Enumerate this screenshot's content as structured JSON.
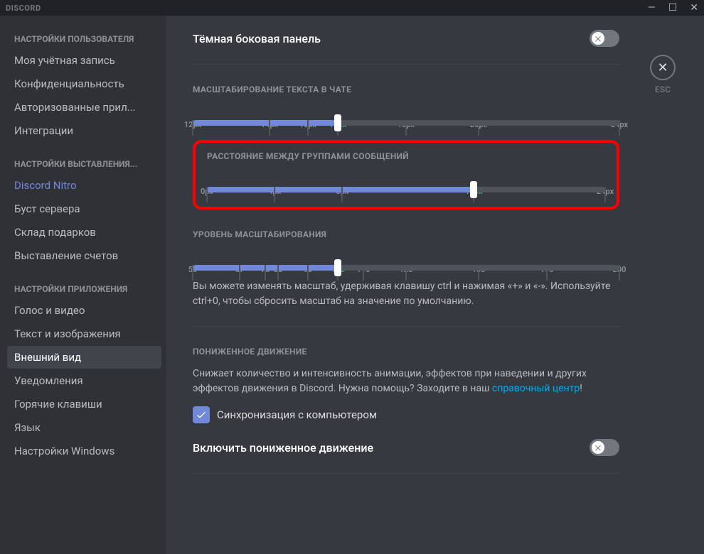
{
  "app": {
    "logo": "DISCORD",
    "esc": "ESC"
  },
  "sidebar": {
    "h1": "НАСТРОЙКИ ПОЛЬЗОВАТЕЛЯ",
    "items1": [
      "Моя учётная запись",
      "Конфиденциальность",
      "Авторизованные прил...",
      "Интеграции"
    ],
    "h2": "НАСТРОЙКИ ВЫСТАВЛЕНИЯ...",
    "items2": [
      "Discord Nitro",
      "Буст сервера",
      "Склад подарков",
      "Выставление счетов"
    ],
    "h3": "НАСТРОЙКИ ПРИЛОЖЕНИЯ",
    "items3": [
      "Голос и видео",
      "Текст и изображения",
      "Внешний вид",
      "Уведомления",
      "Горячие клавиши",
      "Язык",
      "Настройки Windows"
    ]
  },
  "content": {
    "dark_sidebar": "Тёмная боковая панель",
    "chat_scale": {
      "title": "МАСШТАБИРОВАНИЕ ТЕКСТА В ЧАТЕ",
      "ticks": [
        "12px",
        "14px",
        "15px",
        "16px",
        "18px",
        "20px",
        "24px"
      ],
      "active_index": 3
    },
    "msg_spacing": {
      "title": "РАССТОЯНИЕ МЕЖДУ ГРУППАМИ СООБЩЕНИЙ",
      "ticks": [
        "0px",
        "4px",
        "8px",
        "16px",
        "24px"
      ],
      "active_index": 3
    },
    "zoom": {
      "title": "УРОВЕНЬ МАСШТАБИРОВАНИЯ",
      "ticks": [
        "50",
        "67",
        "75",
        "80",
        "90",
        "100",
        "110",
        "125",
        "150",
        "175",
        "200"
      ],
      "active_index": 5,
      "hint": "Вы можете изменять масштаб, удерживая клавишу ctrl и нажимая «+» и «-». Используйте ctrl+0, чтобы сбросить масштаб на значение по умолчанию."
    },
    "reduced_motion": {
      "title": "ПОНИЖЕННОЕ ДВИЖЕНИЕ",
      "desc_a": "Снижает количество и интенсивность анимации, эффектов при наведении и других эффектов движения в Discord. Нужна помощь? Заходите в наш ",
      "link": "справочный центр",
      "desc_b": "!",
      "sync": "Синхронизация с компьютером",
      "enable": "Включить пониженное движение"
    }
  }
}
